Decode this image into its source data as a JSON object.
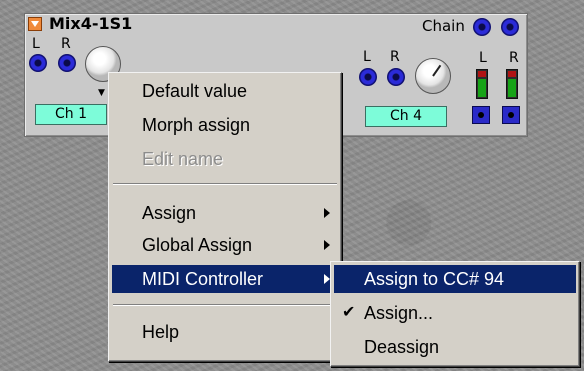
{
  "module": {
    "title": "Mix4-1S1",
    "chain_label": "Chain",
    "L": "L",
    "R": "R",
    "channels": [
      "Ch 1",
      "Ch 4"
    ]
  },
  "context_menu": {
    "items": [
      {
        "label": "Default value",
        "enabled": true
      },
      {
        "label": "Morph assign",
        "enabled": true
      },
      {
        "label": "Edit name",
        "enabled": false
      },
      {
        "label": "Assign",
        "enabled": true,
        "submenu": true
      },
      {
        "label": "Global Assign",
        "enabled": true,
        "submenu": true
      },
      {
        "label": "MIDI Controller",
        "enabled": true,
        "submenu": true,
        "highlighted": true
      },
      {
        "label": "Help",
        "enabled": true
      }
    ]
  },
  "midi_submenu": {
    "items": [
      {
        "label": "Assign to CC# 94",
        "highlighted": true
      },
      {
        "label": "Assign...",
        "checked": true
      },
      {
        "label": "Deassign"
      }
    ],
    "check_glyph": "✔"
  },
  "icons": [
    "dropdown-triangle-icon",
    "submenu-arrow-icon",
    "checkmark-icon"
  ],
  "colors": {
    "highlight": "#0a246a",
    "menu_bg": "#d4d0c8",
    "channel_button": "#7dfcd9",
    "jack": "#2b2bd8",
    "module_toggle": "#f08a3a"
  }
}
